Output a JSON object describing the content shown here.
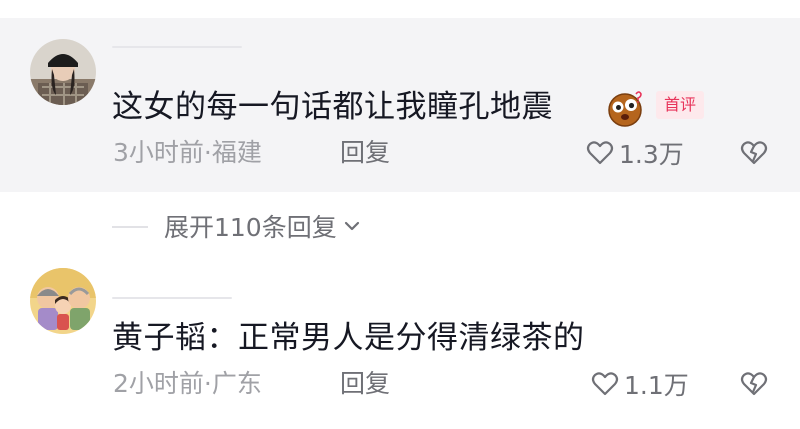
{
  "comments": [
    {
      "text": "这女的每一句话都让我瞳孔地震",
      "badge": "首评",
      "emoji": "shocked-face-emoji",
      "time": "3小时前",
      "location": "福建",
      "reply_label": "回复",
      "like_count": "1.3万",
      "highlighted": true
    },
    {
      "text": "黄子韬：正常男人是分得清绿茶的",
      "time": "2小时前",
      "location": "广东",
      "reply_label": "回复",
      "like_count": "1.1万",
      "highlighted": false
    }
  ],
  "expand_replies_label": "展开110条回复",
  "separator": "·",
  "icons": {
    "like": "heart-outline-icon",
    "dislike": "broken-heart-icon",
    "expand": "chevron-down-icon"
  },
  "colors": {
    "badge_bg": "#fde9ec",
    "badge_text": "#e8345a",
    "highlight_bg": "#f4f4f6"
  }
}
